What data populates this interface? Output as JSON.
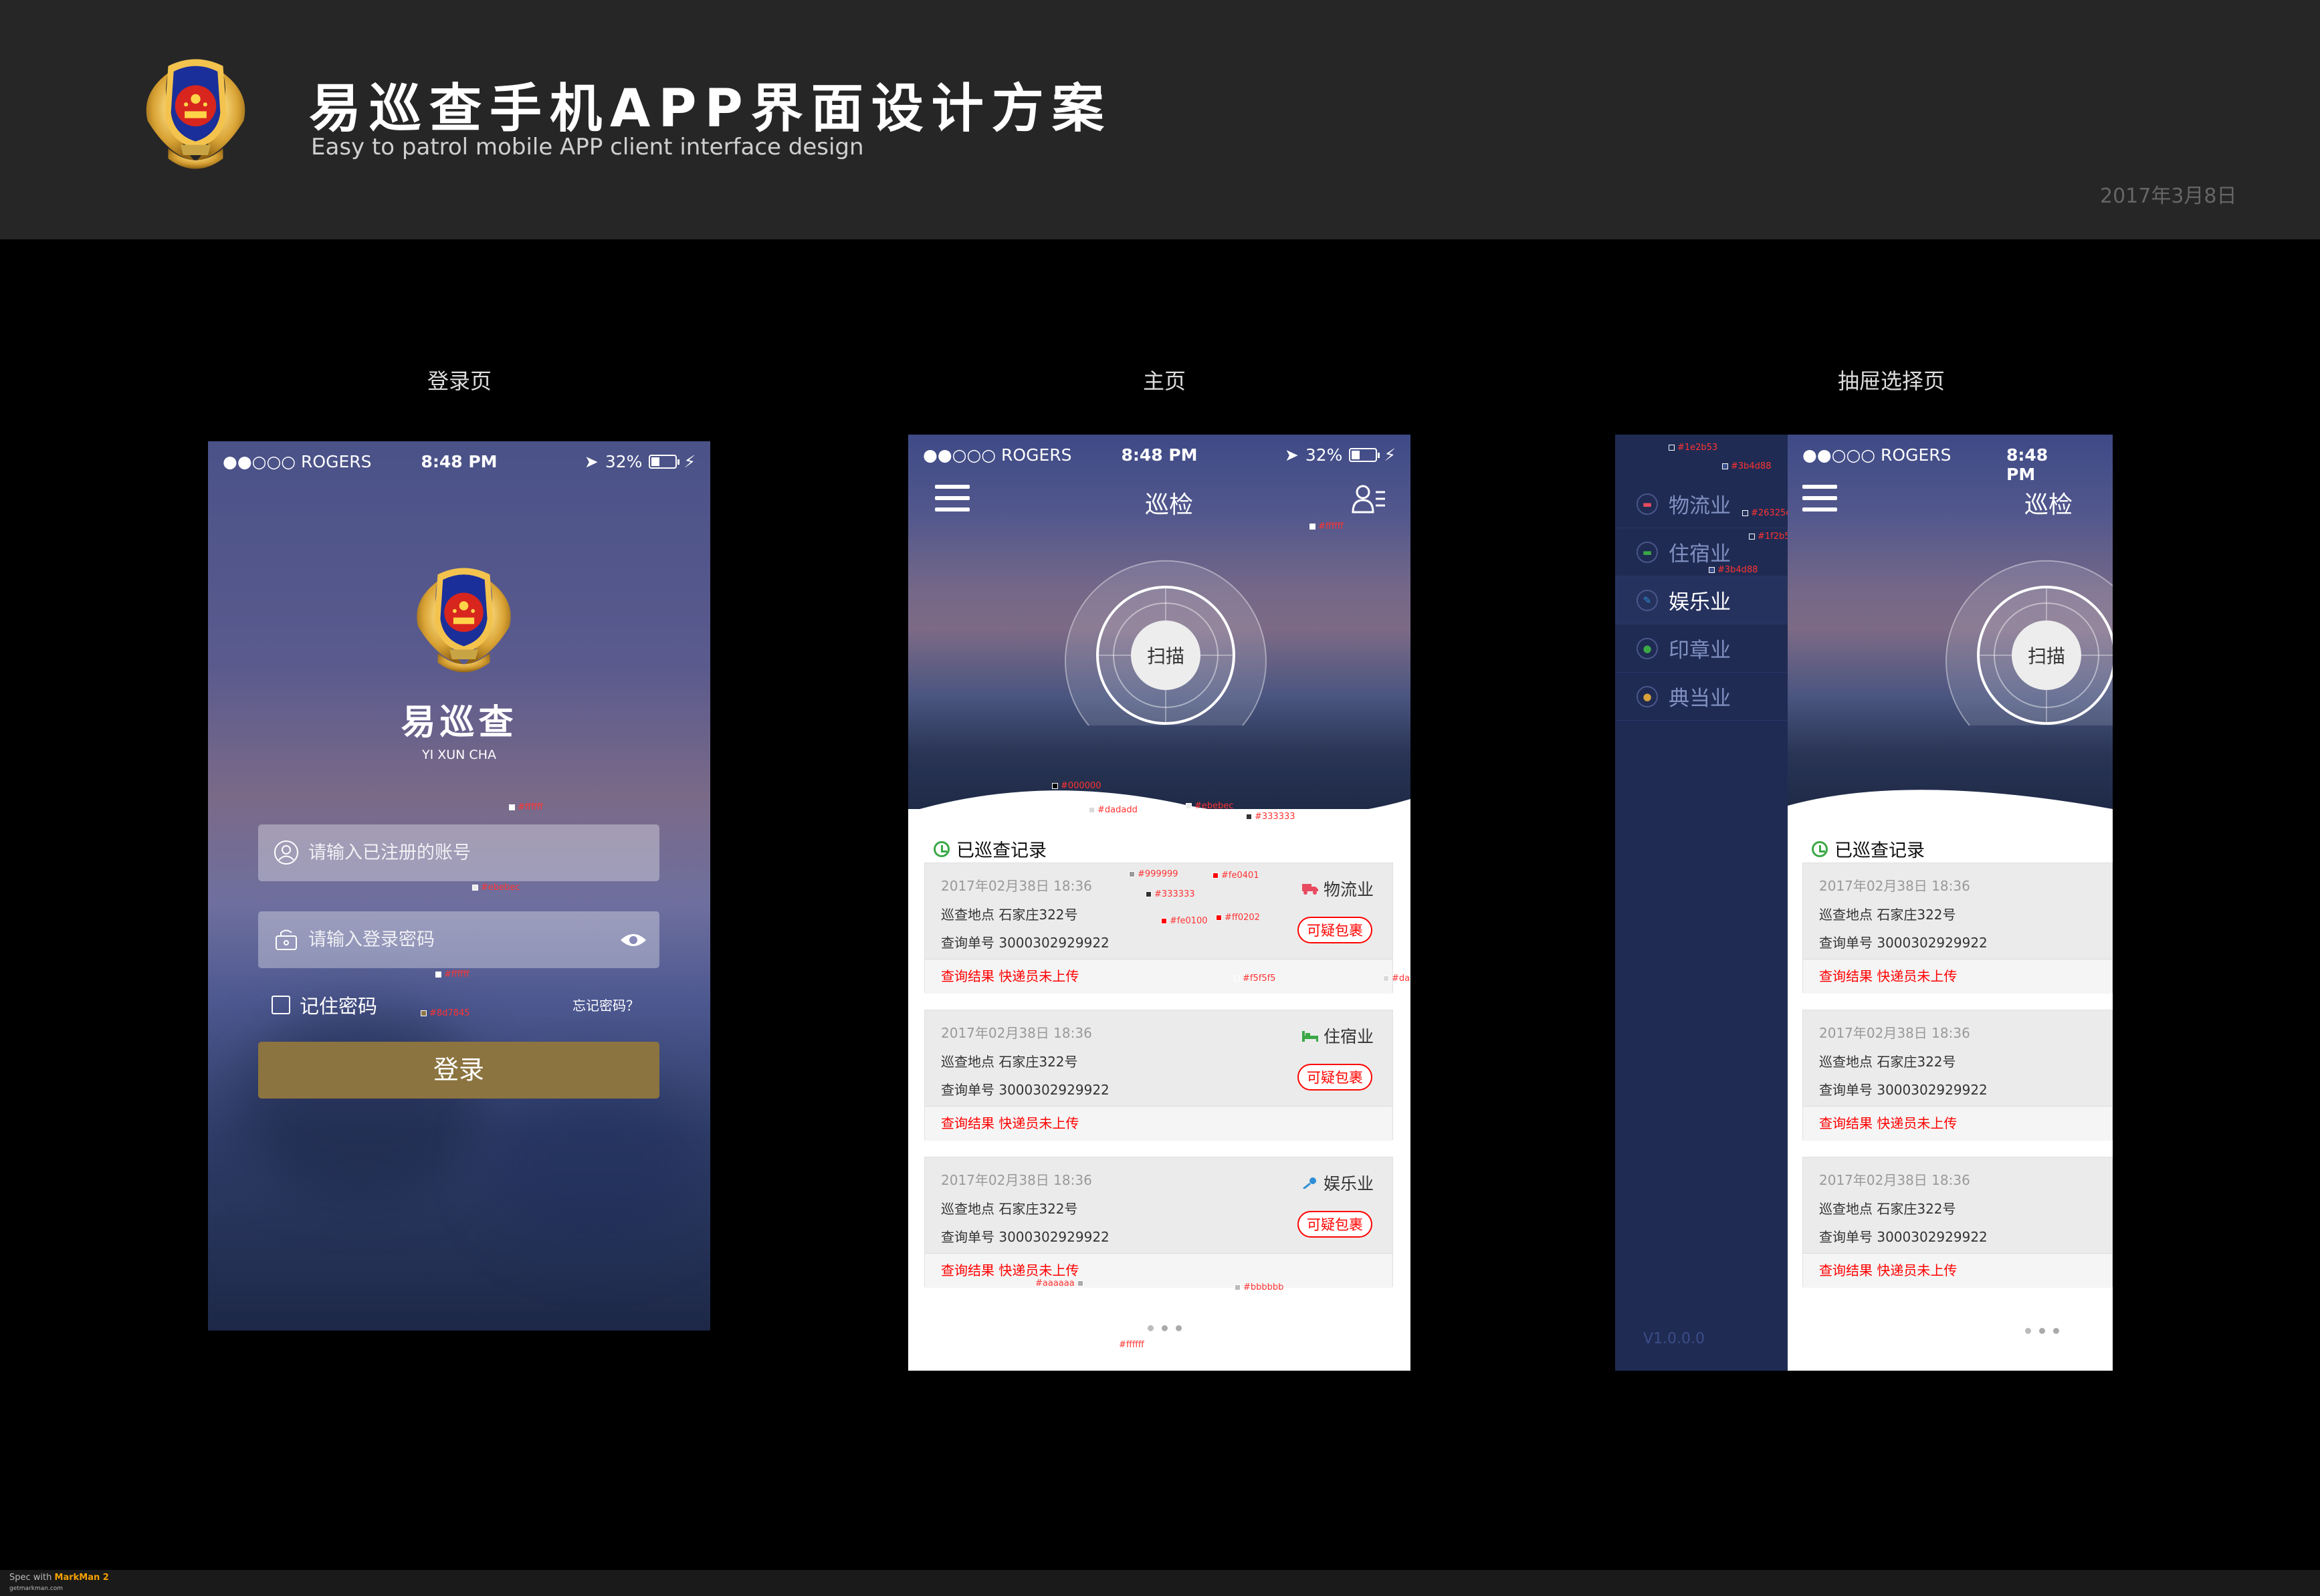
{
  "header": {
    "title": "易巡查手机APP界面设计方案",
    "subtitle": "Easy to patrol mobile APP client interface design",
    "date": "2017年3月8日"
  },
  "sections": {
    "login": "登录页",
    "home": "主页",
    "drawer": "抽屉选择页"
  },
  "status": {
    "carrier": "●●○○○ ROGERS",
    "time": "8:48 PM",
    "battery": "32%"
  },
  "login": {
    "app_name": "易巡查",
    "app_name_en": "YI XUN CHA",
    "account_placeholder": "请输入已注册的账号",
    "password_placeholder": "请输入登录密码",
    "remember": "记住密码",
    "forgot": "忘记密码？",
    "button": "登录"
  },
  "home": {
    "nav_title": "巡检",
    "scan": "扫描",
    "records_title": "已巡查记录",
    "records": [
      {
        "time": "2017年02月38日  18:36",
        "location": "巡查地点   石家庄322号",
        "number": "查询单号   3000302929922",
        "category": "物流业",
        "tag": "可疑包裹",
        "result": "查询结果   快递员未上传"
      },
      {
        "time": "2017年02月38日  18:36",
        "location": "巡查地点   石家庄322号",
        "number": "查询单号   3000302929922",
        "category": "住宿业",
        "tag": "可疑包裹",
        "result": "查询结果   快递员未上传"
      },
      {
        "time": "2017年02月38日  18:36",
        "location": "巡查地点   石家庄322号",
        "number": "查询单号   3000302929922",
        "category": "娱乐业",
        "tag": "可疑包裹",
        "result": "查询结果   快递员未上传"
      }
    ]
  },
  "annotations": {
    "a1": "#ffffff",
    "a2": "#ebebec",
    "a3": "#ffffff",
    "b1": "#000000",
    "b2": "#ebebec",
    "b3": "#dadadd",
    "b4": "#333333",
    "b5": "#999999",
    "b6": "#333333",
    "b7": "#fe0401",
    "b8": "#fe0100",
    "b9": "#ff0202",
    "b10": "#f5f5f5",
    "b11": "#dadadd",
    "b12": "#aaaaaa",
    "b13": "#bbbbbb",
    "b14": "#ffffff",
    "c1": "#ffffff",
    "c2": "#ffffff",
    "c3": "#8d7845",
    "d1": "#1e2b53",
    "d2": "#3b4d88",
    "d3": "#26325e",
    "d4": "#1f2b53",
    "d5": "#3b4d88"
  },
  "drawer": {
    "items": [
      "物流业",
      "住宿业",
      "娱乐业",
      "印章业",
      "典当业"
    ],
    "version": "V1.0.0.0",
    "records": [
      {
        "time": "2017年02月38日  18:36",
        "location": "巡查地点   石家庄322号",
        "number": "查询单号   3000302929922",
        "result": "查询结果   快递员未上传"
      },
      {
        "time": "2017年02月38日  18:36",
        "location": "巡查地点   石家庄322号",
        "number": "查询单号   3000302929922",
        "result": "查询结果   快递员未上传"
      },
      {
        "time": "2017年02月38日  18:36",
        "location": "巡查地点   石家庄322号",
        "number": "查询单号   3000302929922",
        "result": "查询结果   快递员未上传"
      }
    ]
  },
  "footer": {
    "spec": "Spec with",
    "brand": "MarkMan 2",
    "url": "getmarkman.com"
  },
  "colors": {
    "gold": "#8c7440",
    "red": "#fe0401",
    "green": "#3ba846",
    "drawer": "#1f2b53"
  }
}
